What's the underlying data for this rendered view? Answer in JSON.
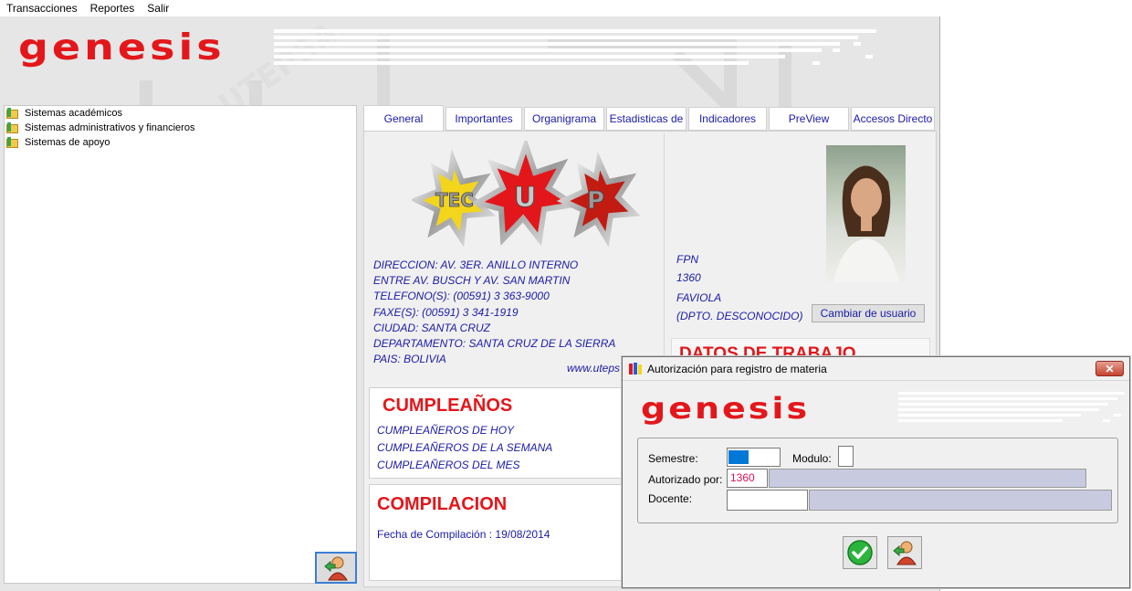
{
  "menu": {
    "items": [
      "Transacciones",
      "Reportes",
      "Salir"
    ]
  },
  "app": {
    "logo_text": "genesis"
  },
  "tree": {
    "items": [
      {
        "label": "Sistemas académicos"
      },
      {
        "label": "Sistemas administrativos y financieros"
      },
      {
        "label": "Sistemas de apoyo"
      }
    ]
  },
  "tabs": [
    {
      "label": "General",
      "active": true
    },
    {
      "label": "Importantes"
    },
    {
      "label": "Organigrama"
    },
    {
      "label": "Estadisticas de"
    },
    {
      "label": "Indicadores"
    },
    {
      "label": "PreView"
    },
    {
      "label": "Accesos Directo"
    }
  ],
  "general": {
    "star_labels": [
      "TEC",
      "U",
      "P"
    ],
    "address_lines": [
      "DIRECCION: AV. 3ER. ANILLO INTERNO",
      "ENTRE AV. BUSCH Y AV. SAN MARTIN",
      "TELEFONO(S): (00591) 3 363-9000",
      "FAXE(S): (00591) 3 341-1919",
      "CIUDAD: SANTA CRUZ",
      "DEPARTAMENTO: SANTA CRUZ DE LA SIERRA",
      "PAIS: BOLIVIA"
    ],
    "website": "www.uteps",
    "user": {
      "code": "FPN",
      "id": "1360",
      "name": "FAVIOLA",
      "dept": "(DPTO. DESCONOCIDO)"
    },
    "change_user_label": "Cambiar de usuario",
    "datos_title": "DATOS DE TRABAJO",
    "birthdays": {
      "title": "CUMPLEAÑOS",
      "links": [
        "CUMPLEAÑEROS DE HOY",
        "CUMPLEAÑEROS DE LA SEMANA",
        "CUMPLEAÑEROS DEL MES"
      ]
    },
    "compilation": {
      "title": "COMPILACION",
      "text": "Fecha de Compilación : 19/08/2014"
    }
  },
  "dialog": {
    "title": "Autorización para registro de materia",
    "close_label": "✕",
    "logo_text": "genesis",
    "semestre_label": "Semestre:",
    "modulo_label": "Modulo:",
    "autorizado_label": "Autorizado por:",
    "autorizado_value": "1360",
    "docente_label": "Docente:"
  },
  "colors": {
    "brand_red": "#e3171b",
    "link_blue": "#1a1aa8",
    "selection_blue": "#0078d7",
    "readonly_field": "#c8cbe0"
  }
}
